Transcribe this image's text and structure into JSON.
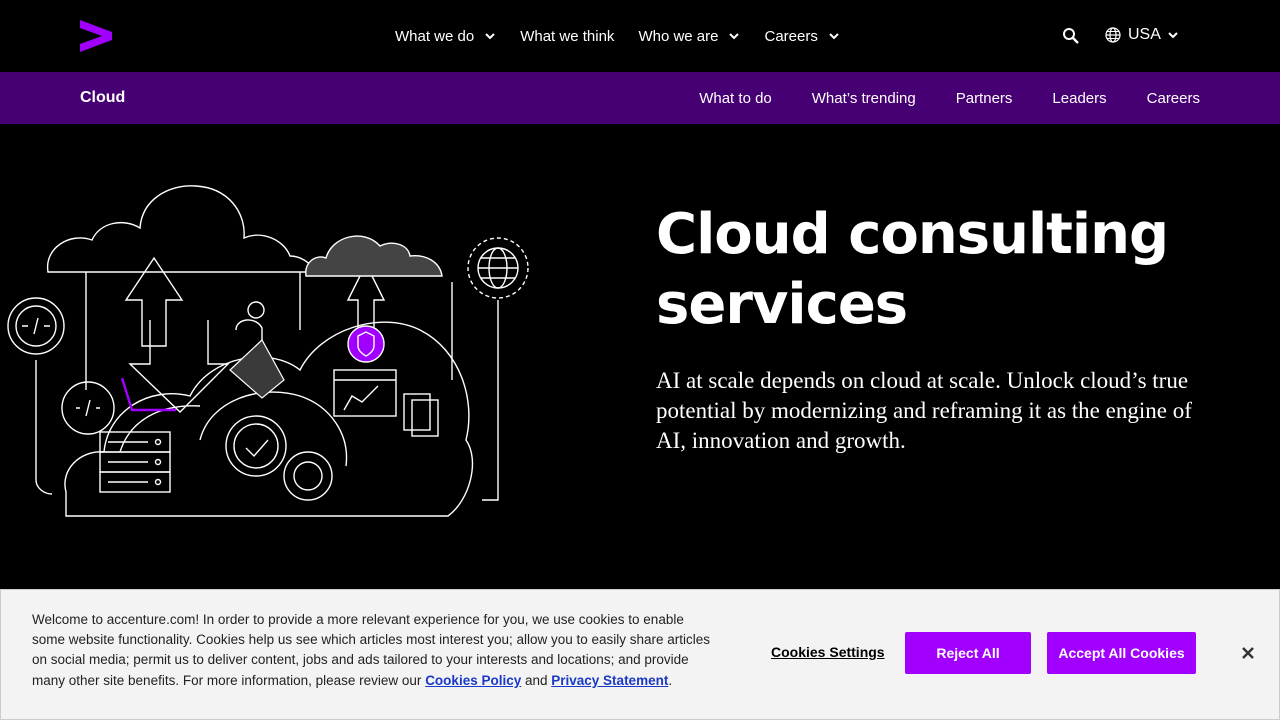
{
  "header": {
    "logo_label": "Accenture",
    "menu": [
      {
        "label": "What we do",
        "has_dropdown": true
      },
      {
        "label": "What we think",
        "has_dropdown": false
      },
      {
        "label": "Who we are",
        "has_dropdown": true
      },
      {
        "label": "Careers",
        "has_dropdown": true
      }
    ],
    "search_icon": "search-icon",
    "locale": "USA"
  },
  "subnav": {
    "title": "Cloud",
    "links": [
      "What to do",
      "What’s trending",
      "Partners",
      "Leaders",
      "Careers"
    ]
  },
  "hero": {
    "title": "Cloud consulting services",
    "description": "AI at scale depends on cloud at scale. Unlock cloud’s true potential by modernizing and reframing it as the engine of AI, innovation and growth."
  },
  "cookie_banner": {
    "text": "Welcome to accenture.com! In order to provide a more relevant experience for you, we use cookies to enable some website functionality. Cookies help us see which articles most interest you; allow you to easily share articles on social media; permit us to deliver content, jobs and ads tailored to your interests and locations; and provide many other site benefits. For more information, please review our ",
    "cookies_policy_link": "Cookies Policy",
    "and_text": " and ",
    "privacy_link": "Privacy Statement",
    "end_text": ".",
    "settings_label": "Cookies Settings",
    "reject_label": "Reject All",
    "accept_label": "Accept All Cookies"
  },
  "colors": {
    "brand_purple": "#a100ff",
    "subnav_bg": "#460073",
    "page_bg": "#000000"
  }
}
